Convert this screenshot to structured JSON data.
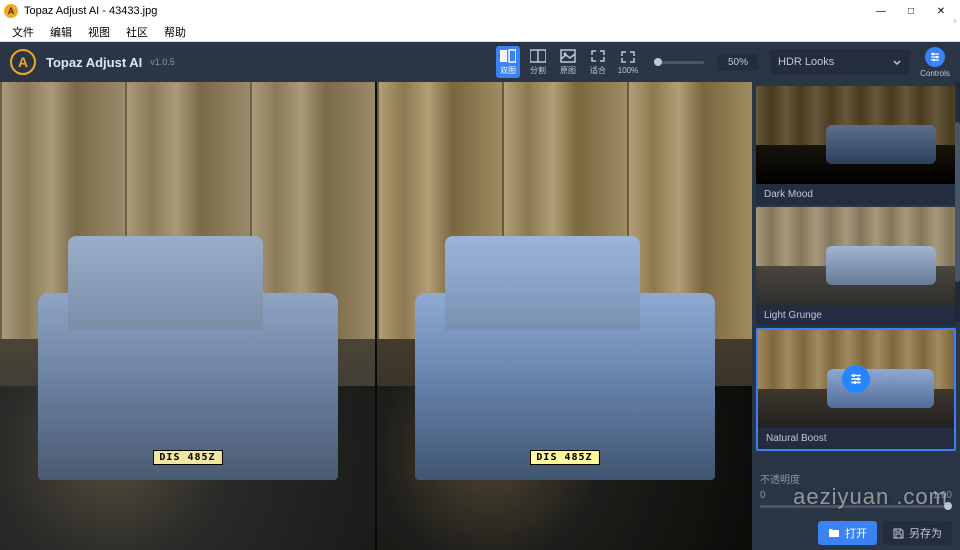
{
  "window": {
    "title": "Topaz Adjust AI - 43433.jpg",
    "min": "—",
    "max": "□",
    "close": "✕"
  },
  "menubar": [
    "文件",
    "编辑",
    "视图",
    "社区",
    "帮助"
  ],
  "header": {
    "logo_letter": "A",
    "app_name": "Topaz Adjust AI",
    "version": "v1.0.5",
    "view_buttons": [
      {
        "label": "双图",
        "active": true
      },
      {
        "label": "分割",
        "active": false
      },
      {
        "label": "原图",
        "active": false
      },
      {
        "label": "适合",
        "active": false
      },
      {
        "label": "100%",
        "active": false
      }
    ],
    "zoom_pct": "50%",
    "hdr_dropdown": "HDR Looks",
    "controls_label": "Controls"
  },
  "viewer": {
    "plate_text": "DIS 485Z"
  },
  "sidebar": {
    "presets": [
      {
        "name": "Dark Mood",
        "thumb_class": "dark",
        "selected": false
      },
      {
        "name": "Light Grunge",
        "thumb_class": "light",
        "selected": false
      },
      {
        "name": "Natural Boost",
        "thumb_class": "natural",
        "selected": true
      }
    ],
    "opacity_label": "不透明度",
    "opacity_min": "0",
    "opacity_max": "1.00"
  },
  "footer": {
    "open": "打开",
    "save_as": "另存为"
  },
  "watermark": "aeziyuan .com"
}
